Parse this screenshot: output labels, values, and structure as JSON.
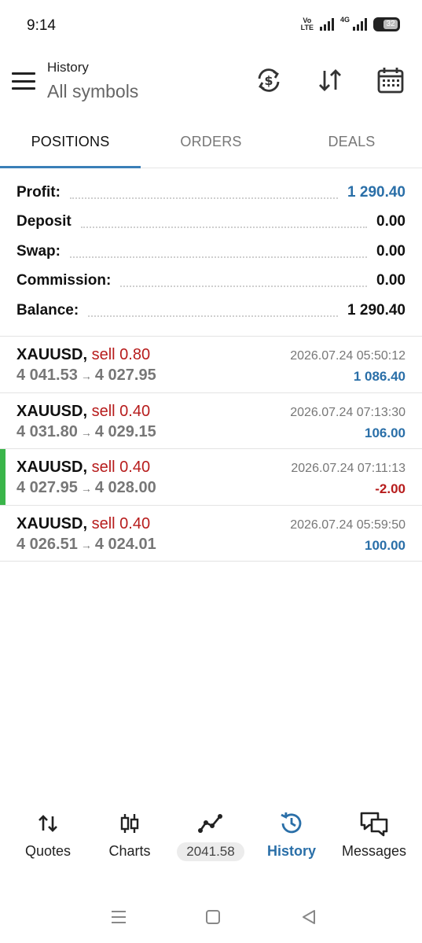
{
  "status_bar": {
    "time": "9:14",
    "volte_top": "Vo",
    "volte_bottom": "LTE",
    "network": "4G",
    "battery": "32"
  },
  "header": {
    "title": "History",
    "subtitle": "All symbols",
    "icons": [
      "currency-exchange-icon",
      "sort-icon",
      "calendar-icon"
    ]
  },
  "tabs": [
    {
      "label": "POSITIONS",
      "active": true
    },
    {
      "label": "ORDERS",
      "active": false
    },
    {
      "label": "DEALS",
      "active": false
    }
  ],
  "summary": [
    {
      "label": "Profit:",
      "value": "1 290.40",
      "highlight": true
    },
    {
      "label": "Deposit",
      "value": "0.00",
      "highlight": false
    },
    {
      "label": "Swap:",
      "value": "0.00",
      "highlight": false
    },
    {
      "label": "Commission:",
      "value": "0.00",
      "highlight": false
    },
    {
      "label": "Balance:",
      "value": "1 290.40",
      "highlight": false
    }
  ],
  "deals": [
    {
      "symbol": "XAUUSD,",
      "side": "sell 0.80",
      "open": "4 041.53",
      "close": "4 027.95",
      "time": "2026.07.24 05:50:12",
      "profit": "1 086.40",
      "negative": false,
      "marked": false
    },
    {
      "symbol": "XAUUSD,",
      "side": "sell 0.40",
      "open": "4 031.80",
      "close": "4 029.15",
      "time": "2026.07.24 07:13:30",
      "profit": "106.00",
      "negative": false,
      "marked": false
    },
    {
      "symbol": "XAUUSD,",
      "side": "sell 0.40",
      "open": "4 027.95",
      "close": "4 028.00",
      "time": "2026.07.24 07:11:13",
      "profit": "-2.00",
      "negative": true,
      "marked": true
    },
    {
      "symbol": "XAUUSD,",
      "side": "sell 0.40",
      "open": "4 026.51",
      "close": "4 024.01",
      "time": "2026.07.24 05:59:50",
      "profit": "100.00",
      "negative": false,
      "marked": false
    }
  ],
  "arrow": "→",
  "bottom_nav": {
    "quotes": "Quotes",
    "charts": "Charts",
    "trade_value": "2041.58",
    "history": "History",
    "messages": "Messages"
  },
  "colors": {
    "accent": "#2a6fa8",
    "loss": "#b71c1c",
    "marker": "#3ab54a"
  }
}
